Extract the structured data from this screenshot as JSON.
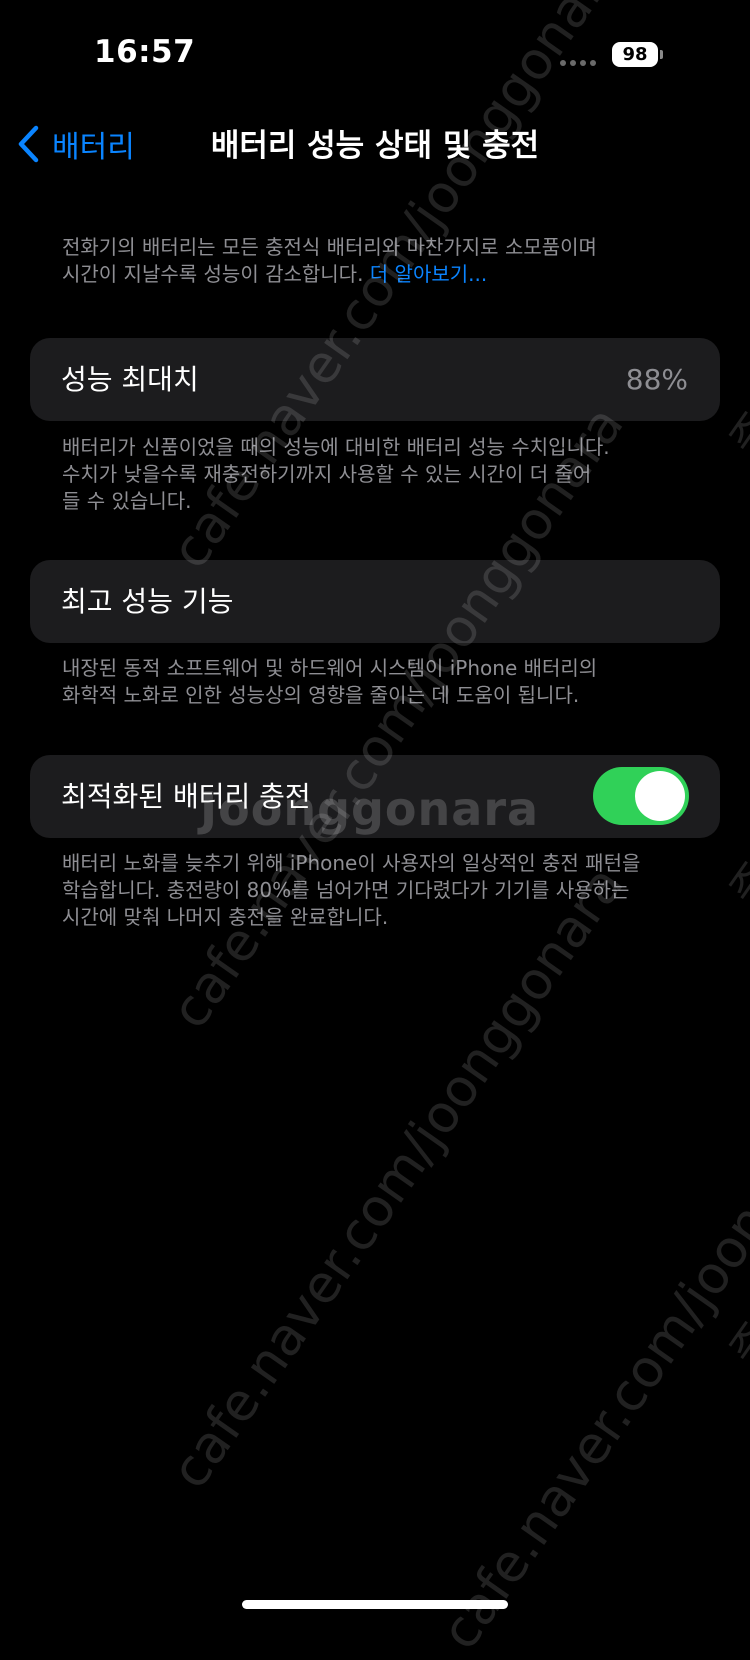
{
  "status_bar": {
    "time": "16:57",
    "battery_level": "98"
  },
  "nav": {
    "back_label": "배터리",
    "title": "배터리 성능 상태 및 충전"
  },
  "intro": {
    "line1": "전화기의 배터리는 모든 충전식 배터리와 마찬가지로 소모품이며",
    "line2": "시간이 지날수록 성능이 감소합니다.",
    "learn_more": "더 알아보기..."
  },
  "max_capacity": {
    "label": "성능 최대치",
    "value": "88%",
    "footnote_line1": "배터리가 신품이었을 때의 성능에 대비한 배터리 성능 수치입니다.",
    "footnote_line2": "수치가 낮을수록 재충전하기까지 사용할 수 있는 시간이 더 줄어",
    "footnote_line3": "들 수 있습니다."
  },
  "peak_performance": {
    "label": "최고 성능 기능",
    "footnote_line1": "내장된 동적 소프트웨어 및 하드웨어 시스템이 iPhone 배터리의",
    "footnote_line2": "화학적 노화로 인한 성능상의 영향을 줄이는 데 도움이 됩니다."
  },
  "optimized_charging": {
    "label": "최적화된 배터리 충전",
    "enabled": true,
    "footnote_line1": "배터리 노화를 늦추기 위해 iPhone이 사용자의 일상적인 충전 패턴을",
    "footnote_line2": "학습합니다. 충전량이 80%를 넘어가면 기다렸다가 기기를 사용하는",
    "footnote_line3": "시간에 맞춰 나머지 충전을 완료합니다."
  },
  "watermark": {
    "url_text": "cafe.naver.com/joonggonara",
    "logo_text": "Joonggonara",
    "edge_text": "중고나라"
  },
  "colors": {
    "background": "#000000",
    "card": "#1c1c1e",
    "accent_blue": "#0a84ff",
    "toggle_on": "#30d158",
    "secondary_text": "#8e8e93"
  },
  "icons": {
    "back": "chevron-left-icon"
  }
}
